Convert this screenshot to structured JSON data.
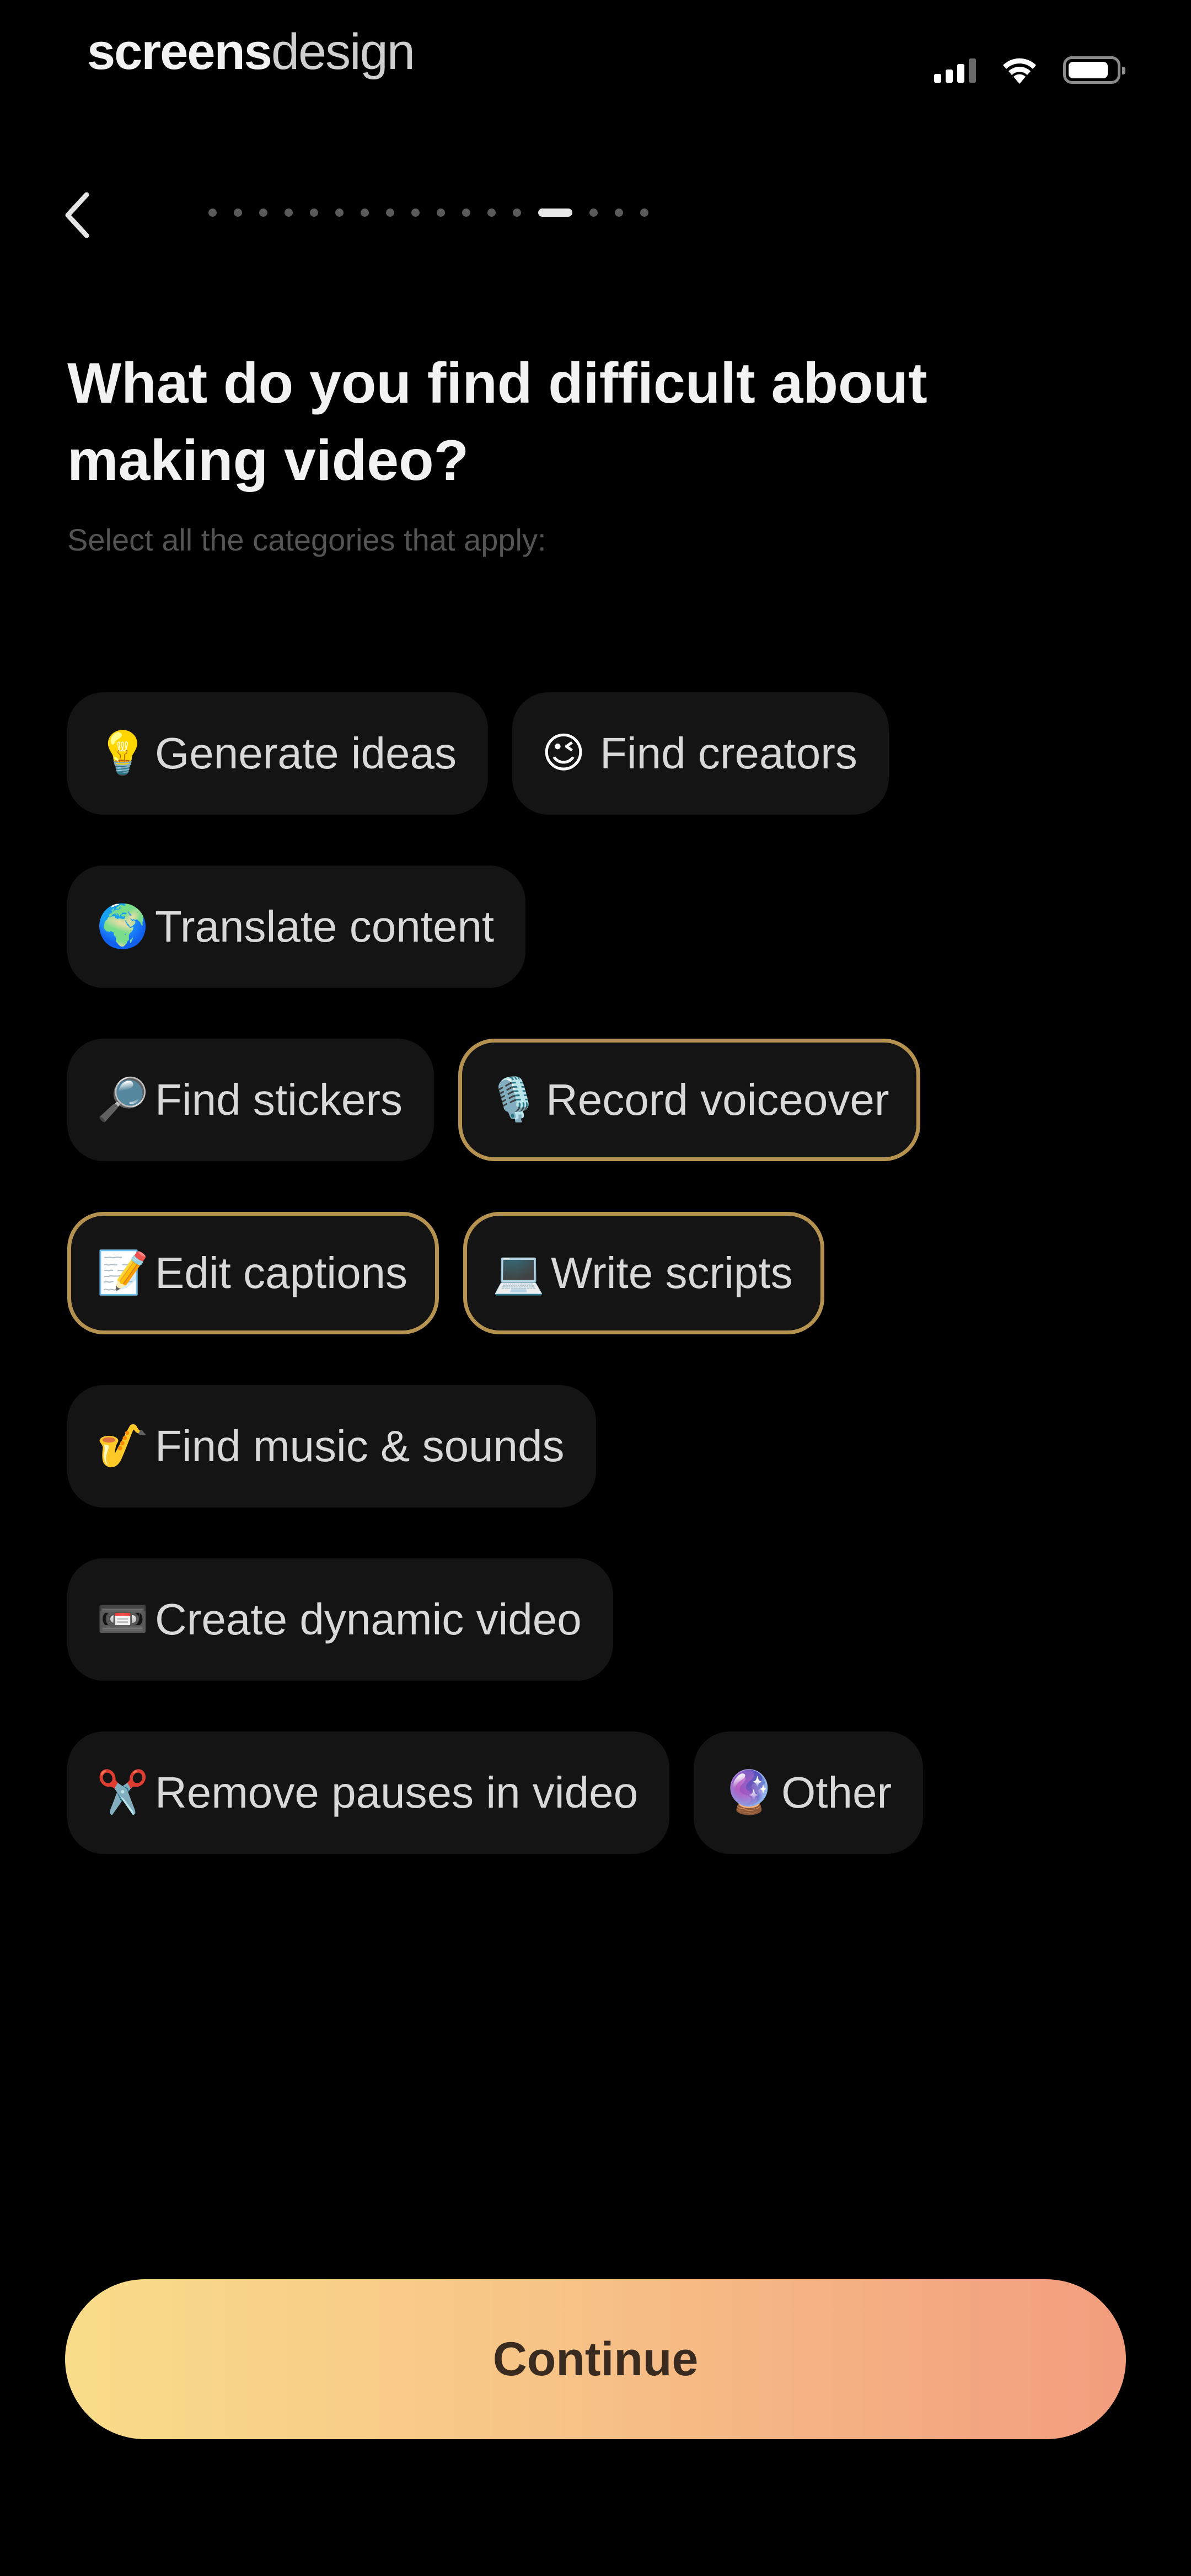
{
  "status_bar": {
    "brand_bold": "screens",
    "brand_light": "design"
  },
  "nav": {
    "progress_total": 17,
    "progress_current": 14
  },
  "question": {
    "title": "What do you find difficult about making video?",
    "subtitle": "Select all the categories that apply:"
  },
  "options": [
    {
      "emoji": "💡",
      "label": "Generate ideas",
      "selected": false
    },
    {
      "emoji": "😉",
      "label": "Find creators",
      "selected": false
    },
    {
      "emoji": "🌍",
      "label": "Translate content",
      "selected": false
    },
    {
      "emoji": "🔎",
      "label": "Find stickers",
      "selected": false
    },
    {
      "emoji": "🎙️",
      "label": "Record voiceover",
      "selected": true
    },
    {
      "emoji": "📝",
      "label": "Edit captions",
      "selected": true
    },
    {
      "emoji": "💻",
      "label": "Write scripts",
      "selected": true
    },
    {
      "emoji": "🎷",
      "label": "Find music & sounds",
      "selected": false
    },
    {
      "emoji": "📼",
      "label": "Create dynamic video",
      "selected": false
    },
    {
      "emoji": "✂️",
      "label": "Remove pauses in video",
      "selected": false
    },
    {
      "emoji": "🔮",
      "label": "Other",
      "selected": false
    }
  ],
  "footer": {
    "continue_label": "Continue"
  },
  "colors": {
    "background": "#000000",
    "chip_background": "#141414",
    "selected_border": "#b5924f",
    "button_gradient_start": "#f9dd8a",
    "button_gradient_end": "#f29d7e"
  },
  "icons": {
    "back": "chevron-left-icon",
    "signal": "cellular-signal-icon",
    "wifi": "wifi-icon",
    "battery": "battery-icon"
  }
}
